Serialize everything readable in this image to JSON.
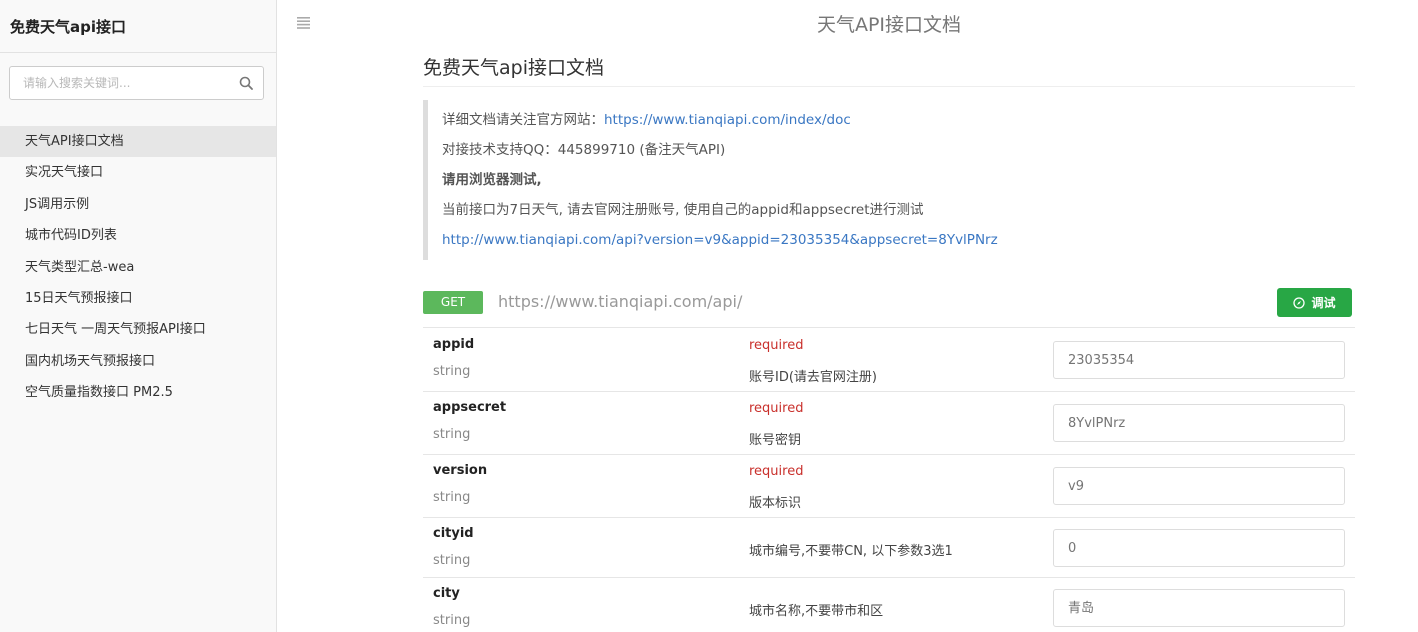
{
  "sidebar": {
    "brand": "免费天气api接口",
    "search_placeholder": "请输入搜索关键词...",
    "items": [
      {
        "label": "天气API接口文档",
        "active": true
      },
      {
        "label": "实况天气接口"
      },
      {
        "label": "JS调用示例"
      },
      {
        "label": "城市代码ID列表"
      },
      {
        "label": "天气类型汇总-wea"
      },
      {
        "label": "15日天气预报接口"
      },
      {
        "label": "七日天气 一周天气预报API接口"
      },
      {
        "label": "国内机场天气预报接口"
      },
      {
        "label": "空气质量指数接口 PM2.5"
      }
    ]
  },
  "header": {
    "title": "天气API接口文档"
  },
  "main": {
    "doc_title": "免费天气api接口文档",
    "intro": {
      "line1_prefix": "详细文档请关注官方网站：",
      "line1_link": "https://www.tianqiapi.com/index/doc",
      "line2": "对接技术支持QQ：445899710 (备注天气API)",
      "line3": "请用浏览器测试,",
      "line4": "当前接口为7日天气, 请去官网注册账号, 使用自己的appid和appsecret进行测试",
      "line5_link": "http://www.tianqiapi.com/api?version=v9&appid=23035354&appsecret=8YvlPNrz"
    },
    "endpoint": {
      "method": "GET",
      "url": "https://www.tianqiapi.com/api/",
      "try_label": "调试"
    },
    "params": [
      {
        "name": "appid",
        "type": "string",
        "required": "required",
        "desc": "账号ID(请去官网注册)",
        "placeholder": "23035354"
      },
      {
        "name": "appsecret",
        "type": "string",
        "required": "required",
        "desc": "账号密钥",
        "placeholder": "8YvlPNrz"
      },
      {
        "name": "version",
        "type": "string",
        "required": "required",
        "desc": "版本标识",
        "placeholder": "v9"
      },
      {
        "name": "cityid",
        "type": "string",
        "required": "",
        "desc": "城市编号,不要带CN, 以下参数3选1",
        "placeholder": "0"
      },
      {
        "name": "city",
        "type": "string",
        "required": "",
        "desc": "城市名称,不要带市和区",
        "placeholder": "青岛"
      }
    ]
  },
  "colors": {
    "get_badge": "#5cb85c",
    "try_button": "#28a745",
    "required": "#c9302c",
    "link": "#3a77c3"
  }
}
